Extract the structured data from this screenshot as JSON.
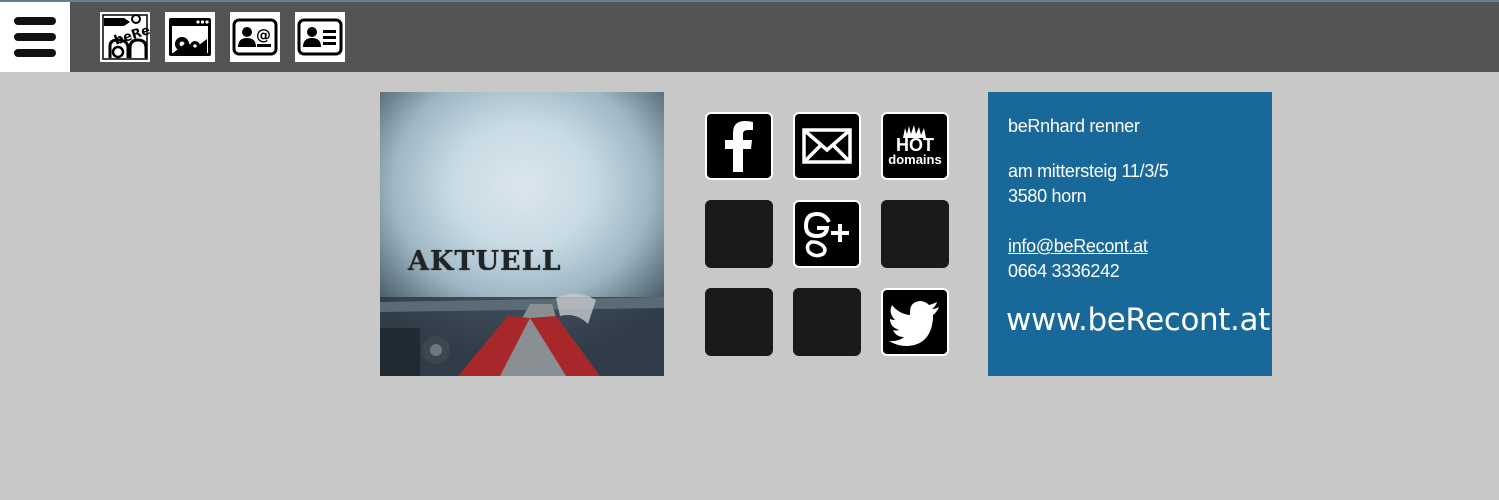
{
  "nav": {
    "icons": [
      {
        "name": "berecont-logo-icon",
        "text": "beRe"
      },
      {
        "name": "browser-settings-icon"
      },
      {
        "name": "contact-email-icon"
      },
      {
        "name": "contact-card-icon"
      }
    ]
  },
  "aktuell": {
    "label": "AKTUELL"
  },
  "social": {
    "hotdomains_top": "HOT",
    "hotdomains_bottom": "domains"
  },
  "contact": {
    "name": "beRnhard renner",
    "street": "am mittersteig 11/3/5",
    "city": "3580 horn",
    "email": "info@beRecont.at",
    "phone": "0664 3336242",
    "website": "www.beRecont.at"
  },
  "colors": {
    "topbar": "#545454",
    "background": "#c8c8c8",
    "contact_box": "#19689a"
  }
}
